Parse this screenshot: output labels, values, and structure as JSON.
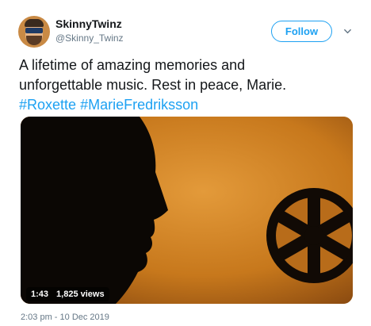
{
  "author": {
    "name": "SkinnyTwinz",
    "handle": "@Skinny_Twinz"
  },
  "follow_label": "Follow",
  "tweet": {
    "text_line1": "A lifetime of amazing memories and",
    "text_line2": "unforgettable music. Rest in peace, Marie.",
    "hashtag1": "#Roxette",
    "hashtag2": "#MarieFredriksson"
  },
  "video": {
    "duration": "1:43",
    "views": "1,825 views"
  },
  "timestamp": "2:03 pm - 10 Dec 2019",
  "colors": {
    "accent": "#1da1f2",
    "secondary_text": "#657786"
  },
  "icons": {
    "more": "chevron-down-icon"
  }
}
